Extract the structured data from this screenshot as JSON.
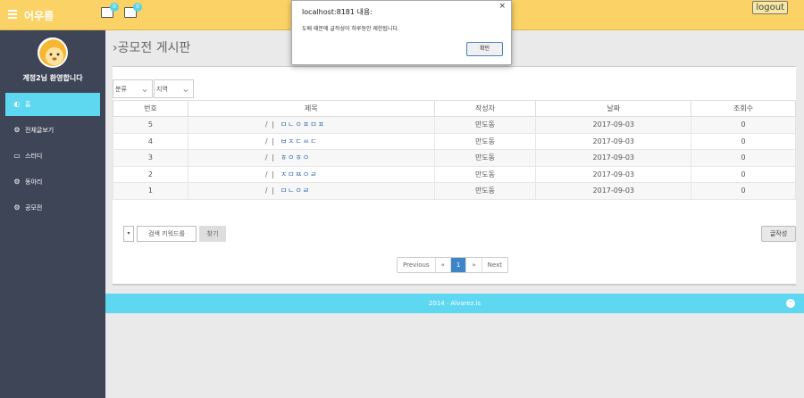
{
  "header": {
    "brand": "어우름",
    "notif_count": "0",
    "mail_count": "0",
    "logout_label": "logout"
  },
  "sidebar": {
    "welcome": "계정2님 환영합니다",
    "items": [
      {
        "label": "홈",
        "icon": "dashboard-icon",
        "active": true
      },
      {
        "label": "전체글보기",
        "icon": "cogs-icon"
      },
      {
        "label": "스터디",
        "icon": "desktop-icon"
      },
      {
        "label": "동아리",
        "icon": "cogs-icon"
      },
      {
        "label": "공모전",
        "icon": "cogs-icon"
      }
    ]
  },
  "page": {
    "title": "공모전 게시판",
    "filter_category": "분류",
    "filter_region": "지역"
  },
  "table": {
    "headers": [
      "번호",
      "제목",
      "작성자",
      "날짜",
      "조회수"
    ],
    "rows": [
      {
        "no": "5",
        "title": "ㅁㄴㅇㅍㅁㅍ",
        "author": "만도동",
        "date": "2017-09-03",
        "views": "0"
      },
      {
        "no": "4",
        "title": "ㅂㅈㄷㅆㄷ",
        "author": "만도동",
        "date": "2017-09-03",
        "views": "0"
      },
      {
        "no": "3",
        "title": "ㅎㅇㅎㅇ",
        "author": "만도동",
        "date": "2017-09-03",
        "views": "0"
      },
      {
        "no": "2",
        "title": "ㅈㅁㅉㅇㄹ",
        "author": "만도동",
        "date": "2017-09-03",
        "views": "0"
      },
      {
        "no": "1",
        "title": "ㅁㄴㅇㄹ",
        "author": "만도동",
        "date": "2017-09-03",
        "views": "0"
      }
    ],
    "title_prefix": "/ |"
  },
  "search": {
    "dropdown": "▾",
    "placeholder": "검색 키워드를",
    "find_label": "찾기",
    "write_label": "글작성"
  },
  "pager": {
    "previous": "Previous",
    "prev_arrow": "«",
    "current": "1",
    "next_arrow": "»",
    "next": "Next"
  },
  "footer": {
    "text": "2014 · Alvarez.is",
    "to_top": "⌃"
  },
  "dialog": {
    "title": "localhost:8181 내용:",
    "message": "도배 때문에 글작성이 하루동안 제한됩니다.",
    "ok_label": "확인",
    "close": "×"
  },
  "colors": {
    "topbar": "#fbd265",
    "sidebar": "#3d4556",
    "accent": "#5dd8f0",
    "pager_active": "#3c85c6"
  }
}
